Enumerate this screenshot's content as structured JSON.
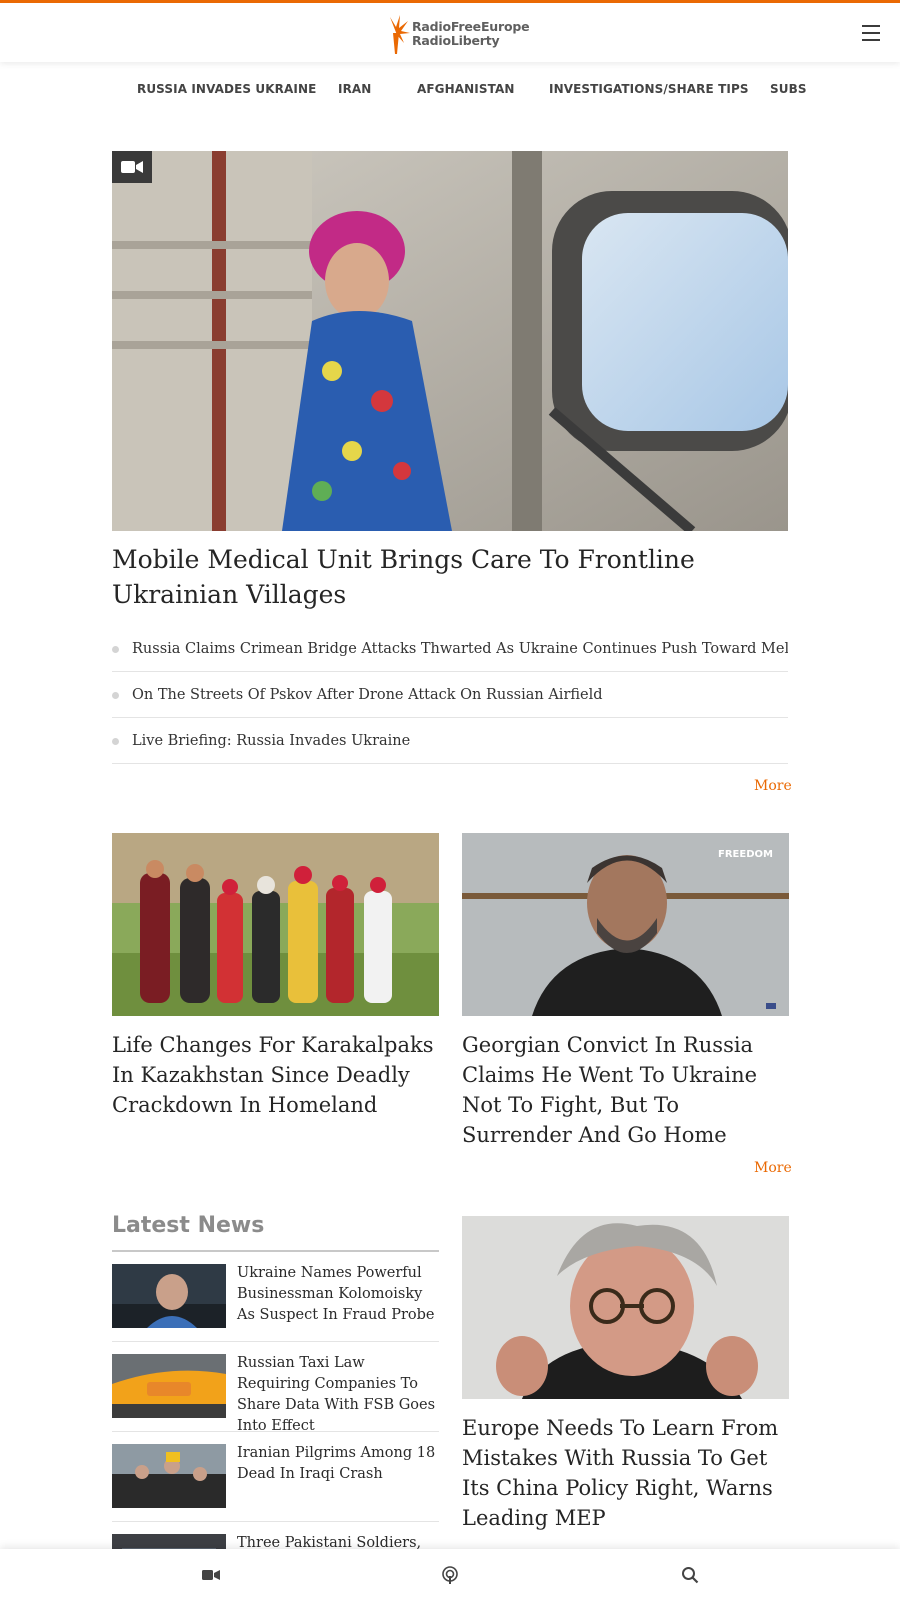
{
  "header": {
    "logo_line1": "RadioFreeEurope",
    "logo_line2": "RadioLiberty",
    "menu_icon": "hamburger-icon"
  },
  "nav": {
    "items": [
      {
        "label": "RUSSIA INVADES UKRAINE"
      },
      {
        "label": "IRAN"
      },
      {
        "label": "AFGHANISTAN"
      },
      {
        "label": "INVESTIGATIONS/SHARE TIPS"
      },
      {
        "label": "SUBS"
      }
    ]
  },
  "hero": {
    "media_icon": "video-camera-icon",
    "title": "Mobile Medical Unit Brings Care To Frontline Ukrainian Villages",
    "related": [
      {
        "title": "Russia Claims Crimean Bridge Attacks Thwarted As Ukraine Continues Push Toward Melitopol"
      },
      {
        "title": "On The Streets Of Pskov After Drone Attack On Russian Airfield"
      },
      {
        "title": "Live Briefing: Russia Invades Ukraine"
      }
    ],
    "more_label": "More"
  },
  "cards": {
    "items": [
      {
        "title": "Life Changes For Karakalpaks In Kazakhstan Since Deadly Crackdown In Homeland"
      },
      {
        "title": "Georgian Convict In Russia Claims He Went To Ukraine Not To Fight, But To Surrender And Go Home",
        "image_watermark": "FREEDOM"
      }
    ],
    "more_label": "More"
  },
  "latest": {
    "heading": "Latest News",
    "items": [
      {
        "title": "Ukraine Names Powerful Businessman Kolomoisky As Suspect In Fraud Probe"
      },
      {
        "title": "Russian Taxi Law Requiring Companies To Share Data With FSB Goes Into Effect"
      },
      {
        "title": "Iranian Pilgrims Among 18 Dead In Iraqi Crash"
      },
      {
        "title": "Three Pakistani Soldiers,"
      }
    ]
  },
  "feature": {
    "title": "Europe Needs To Learn From Mistakes With Russia To Get Its China Policy Right, Warns Leading MEP"
  },
  "bottom_bar": {
    "icons": [
      "video-camera-icon",
      "podcast-icon",
      "search-icon"
    ]
  },
  "colors": {
    "accent": "#ea6903",
    "text": "#252525",
    "muted_heading": "#8b8b8b"
  }
}
